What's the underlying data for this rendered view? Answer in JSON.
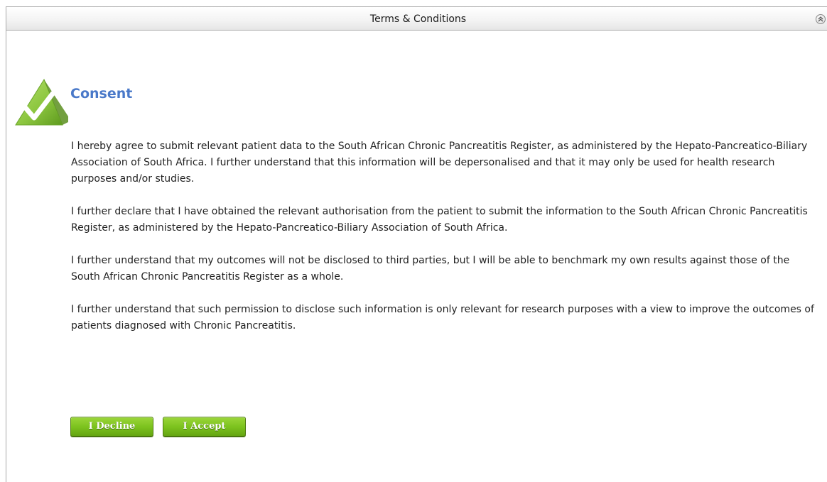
{
  "panel": {
    "title": "Terms & Conditions",
    "collapse_icon": "double-chevron-up-icon"
  },
  "consent": {
    "icon": "checkmark-triangle-icon",
    "heading": "Consent",
    "paragraphs": [
      "I hereby agree to submit relevant patient data to the South African Chronic Pancreatitis Register, as administered by the Hepato-Pancreatico-Biliary Association of South Africa. I further understand that this information will be depersonalised and that it may only be used for health research purposes and/or studies.",
      "I further declare that I have obtained the relevant authorisation from the patient to submit the information to the South African Chronic Pancreatitis Register, as administered by the Hepato-Pancreatico-Biliary Association of South Africa.",
      "I further understand that my outcomes will not be disclosed to third parties, but I will be able to benchmark my own results against those of the South African Chronic Pancreatitis Register as a whole.",
      "I further understand that such permission to disclose such information is only relevant for research purposes with a view to improve the outcomes of patients diagnosed with Chronic Pancreatitis."
    ]
  },
  "actions": {
    "decline_label": "I Decline",
    "accept_label": "I Accept"
  },
  "colors": {
    "heading": "#4a79c9",
    "button_green": "#7dc31f",
    "icon_green": "#8cc63f"
  }
}
